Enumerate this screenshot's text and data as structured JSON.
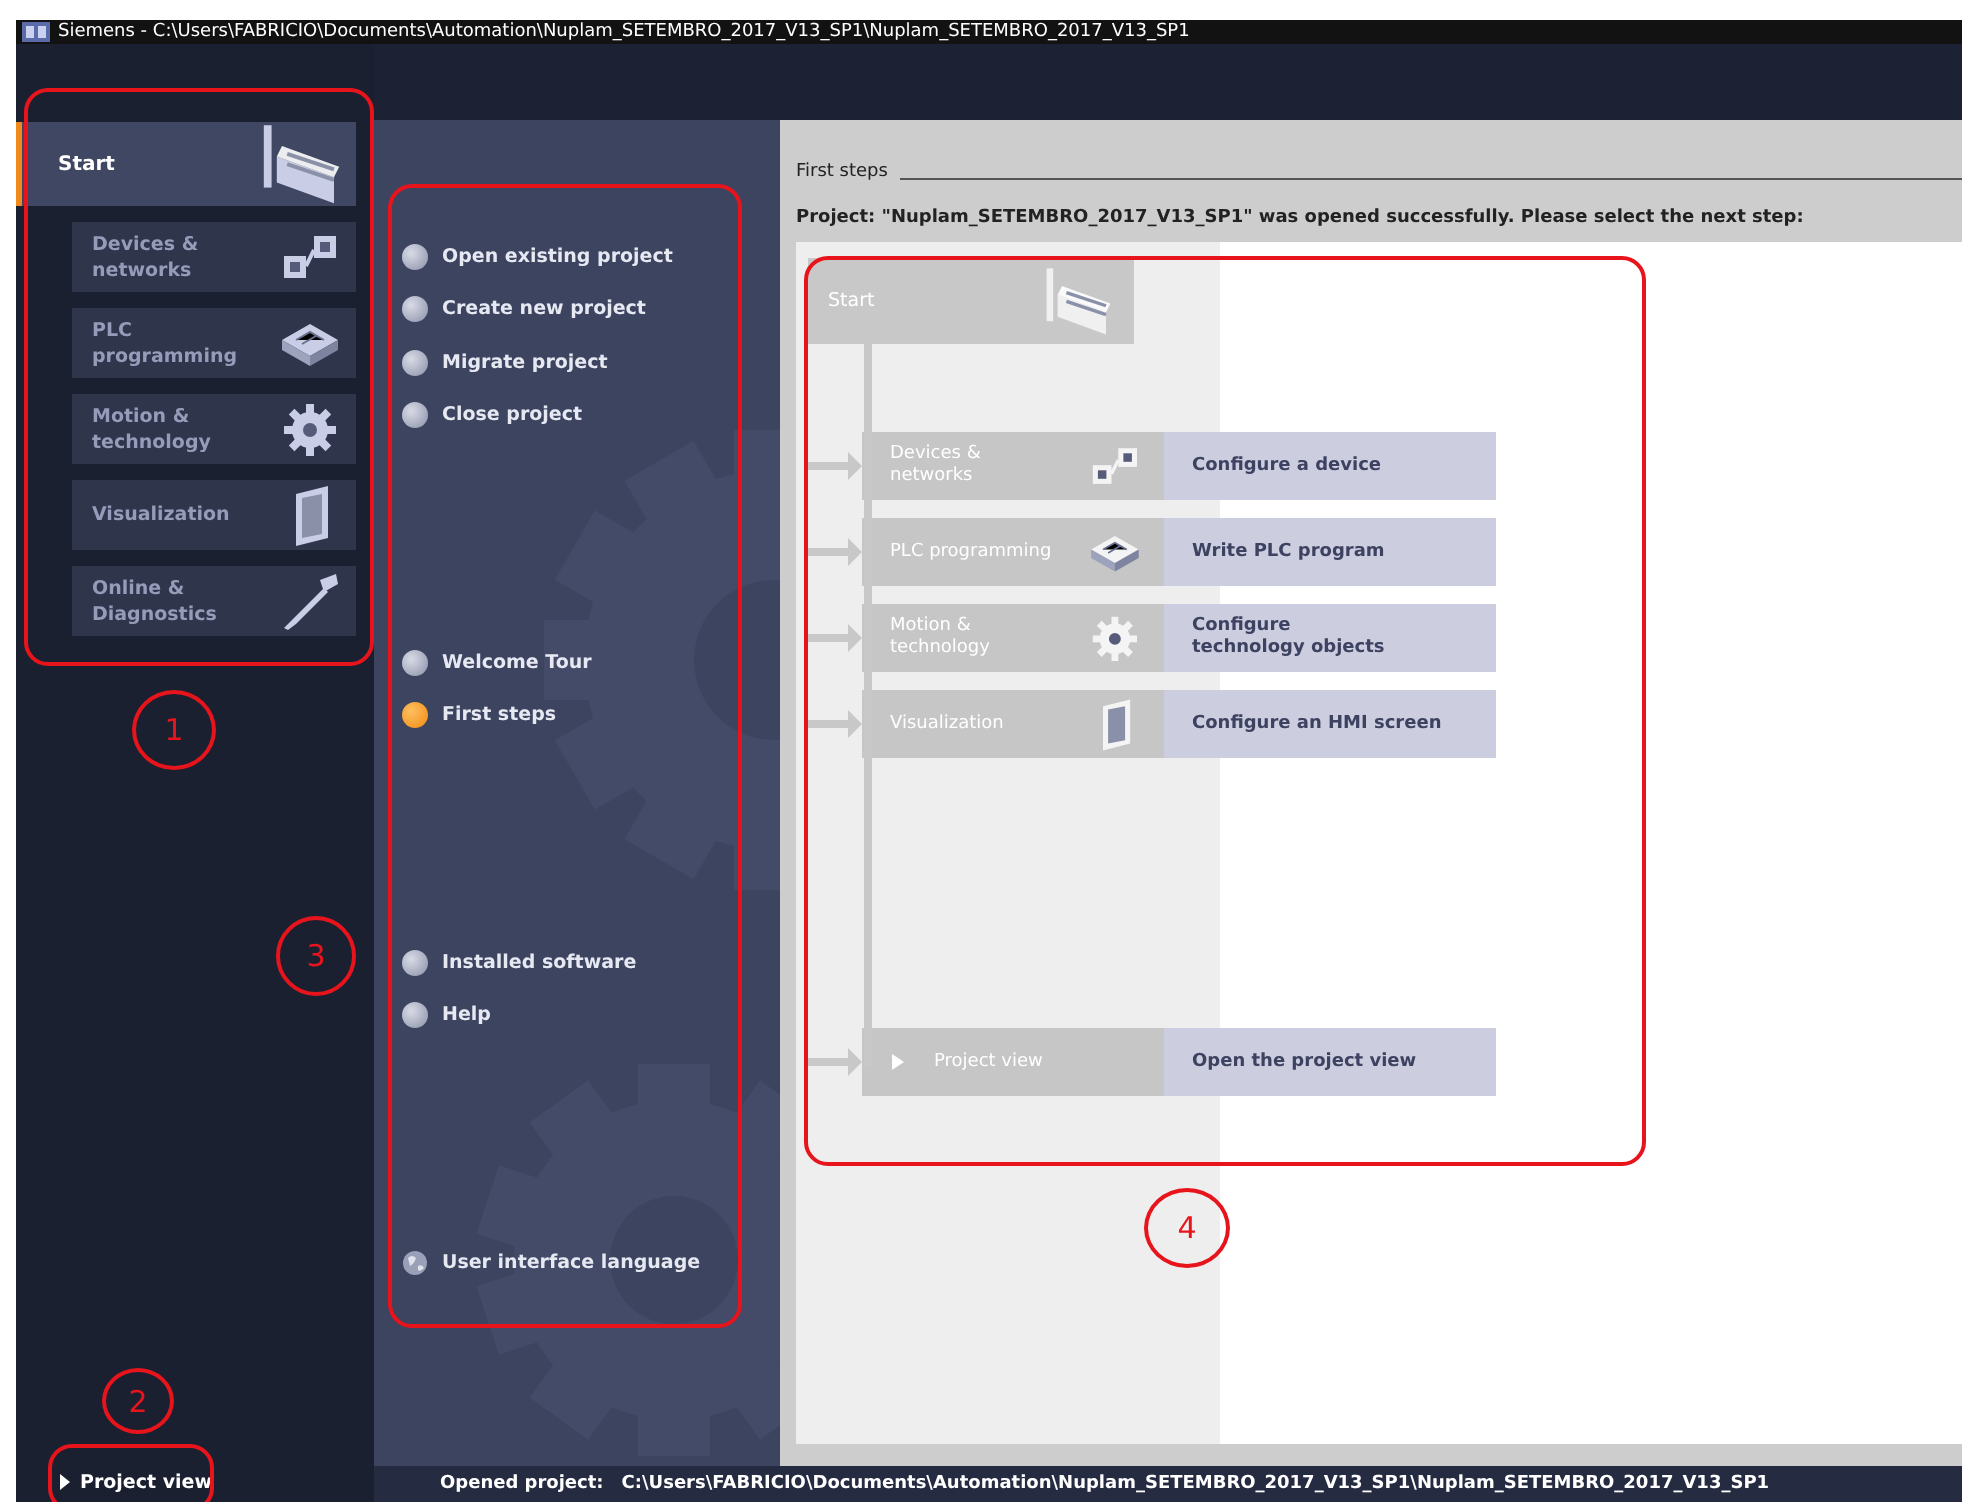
{
  "window": {
    "title": "Siemens  -  C:\\Users\\FABRICIO\\Documents\\Automation\\Nuplam_SETEMBRO_2017_V13_SP1\\Nuplam_SETEMBRO_2017_V13_SP1"
  },
  "portals": [
    {
      "kind": "start",
      "label": "Start",
      "selected": true
    },
    {
      "kind": "devices",
      "label": "Devices &\nnetworks",
      "selected": false
    },
    {
      "kind": "plc",
      "label": "PLC\nprogramming",
      "selected": false
    },
    {
      "kind": "motion",
      "label": "Motion &\ntechnology",
      "selected": false
    },
    {
      "kind": "visualization",
      "label": "Visualization",
      "selected": false
    },
    {
      "kind": "online",
      "label": "Online &\nDiagnostics",
      "selected": false
    }
  ],
  "project_view_link": "Project view",
  "actions": [
    {
      "items": [
        {
          "kind": "bullet",
          "label": "Open existing project",
          "selected": false
        },
        {
          "kind": "bullet",
          "label": "Create new project",
          "selected": false
        },
        {
          "kind": "bullet",
          "label": "Migrate project",
          "selected": false
        },
        {
          "kind": "bullet",
          "label": "Close project",
          "selected": false
        }
      ]
    },
    {
      "items": [
        {
          "kind": "bullet",
          "label": "Welcome Tour",
          "selected": false
        },
        {
          "kind": "bullet",
          "label": "First steps",
          "selected": true
        }
      ]
    },
    {
      "items": [
        {
          "kind": "bullet",
          "label": "Installed software",
          "selected": false
        },
        {
          "kind": "bullet",
          "label": "Help",
          "selected": false
        }
      ]
    },
    {
      "items": [
        {
          "kind": "globe",
          "label": "User interface language",
          "selected": false
        }
      ]
    }
  ],
  "first_steps": {
    "heading": "First steps",
    "message": "Project: \"Nuplam_SETEMBRO_2017_V13_SP1\" was opened successfully. Please select the next step:",
    "start_label": "Start",
    "steps": [
      {
        "kind": "devices",
        "label": "Devices &\nnetworks",
        "action": "Configure a device"
      },
      {
        "kind": "plc",
        "label": "PLC programming",
        "action": "Write PLC program"
      },
      {
        "kind": "motion",
        "label": "Motion &\ntechnology",
        "action": "Configure\ntechnology objects"
      },
      {
        "kind": "visualization",
        "label": "Visualization",
        "action": "Configure an HMI screen"
      },
      {
        "kind": "project_view",
        "label": "Project view",
        "action": "Open the project view"
      }
    ]
  },
  "status_bar": {
    "label": "Opened project:",
    "path": "C:\\Users\\FABRICIO\\Documents\\Automation\\Nuplam_SETEMBRO_2017_V13_SP1\\Nuplam_SETEMBRO_2017_V13_SP1"
  },
  "annotations": [
    {
      "number": "1"
    },
    {
      "number": "2"
    },
    {
      "number": "3"
    },
    {
      "number": "4"
    }
  ]
}
